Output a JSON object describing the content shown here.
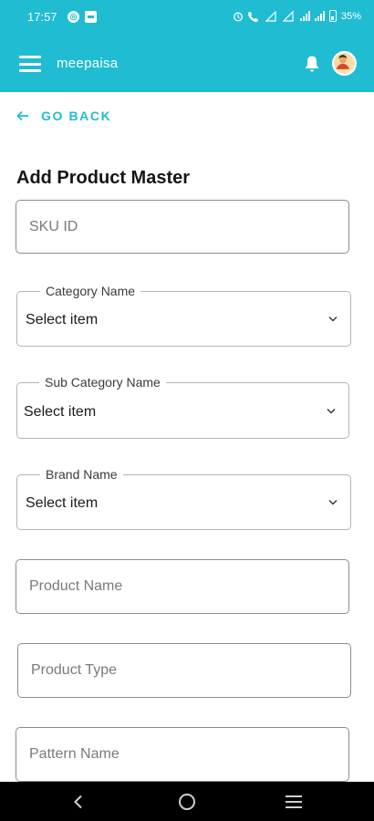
{
  "status_bar": {
    "time": "17:57",
    "battery": "35%",
    "left_icons": [
      "sync-icon",
      "notification-square-icon"
    ],
    "right_icons": [
      "alarm-icon",
      "volte-call-icon",
      "lte-icon",
      "signal-icon",
      "signal-icon",
      "battery-icon"
    ]
  },
  "app_bar": {
    "title": "meepaisa",
    "menu_icon": "hamburger-menu-icon",
    "notification_icon": "bell-icon",
    "avatar_icon": "user-avatar"
  },
  "go_back": {
    "label": "GO BACK",
    "icon": "arrow-left-icon"
  },
  "form": {
    "title": "Add Product Master",
    "sku_placeholder": "SKU ID",
    "category": {
      "label": "Category Name",
      "value": "Select item"
    },
    "sub_category": {
      "label": "Sub Category Name",
      "value": "Select item"
    },
    "brand": {
      "label": "Brand Name",
      "value": "Select item"
    },
    "product_name_placeholder": "Product Name",
    "product_type_placeholder": "Product Type",
    "pattern_name_placeholder": "Pattern Name"
  },
  "colors": {
    "primary": "#1fbcd2",
    "border": "#8c8c8c",
    "nav_bar": "#000000"
  },
  "nav_bar": {
    "icons": [
      "back-icon",
      "home-icon",
      "recents-icon"
    ]
  }
}
